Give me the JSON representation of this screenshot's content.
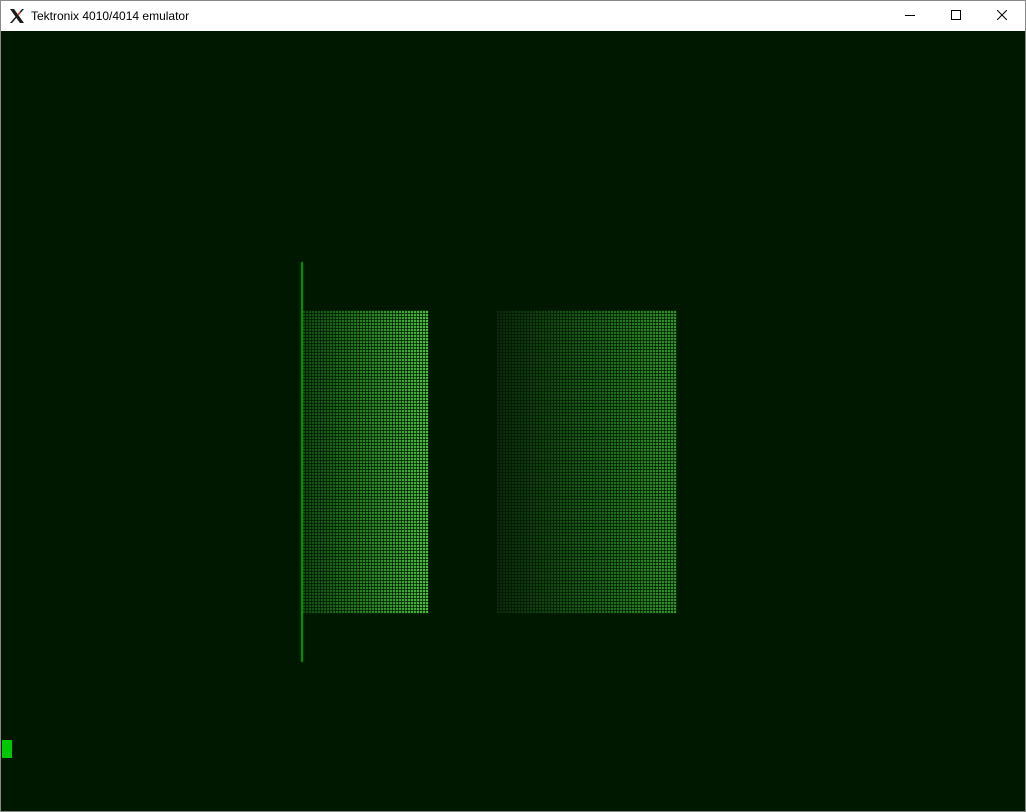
{
  "window": {
    "title": "Tektronix 4010/4014 emulator",
    "icon": "x-window-system-icon",
    "controls": [
      "minimize-icon",
      "maximize-icon",
      "close-icon"
    ]
  },
  "terminal": {
    "background": "#001800",
    "phosphor": "#00c800",
    "cursor": "block"
  }
}
